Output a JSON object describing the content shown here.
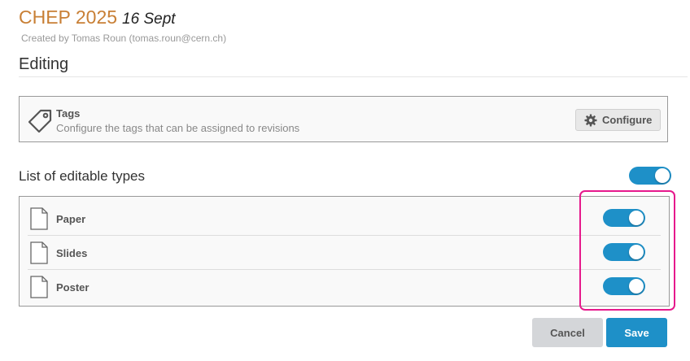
{
  "header": {
    "title": "CHEP 2025",
    "date": "16 Sept",
    "created_by": "Created by Tomas Roun (tomas.roun@cern.ch)"
  },
  "section": {
    "heading": "Editing"
  },
  "tags": {
    "icon": "tag-icon",
    "title": "Tags",
    "description": "Configure the tags that can be assigned to revisions",
    "configure_label": "Configure",
    "configure_icon": "gear-icon"
  },
  "editable_types": {
    "label": "List of editable types",
    "enabled": true,
    "items": [
      {
        "label": "Paper",
        "icon": "file-icon",
        "enabled": true
      },
      {
        "label": "Slides",
        "icon": "file-icon",
        "enabled": true
      },
      {
        "label": "Poster",
        "icon": "file-icon",
        "enabled": true
      }
    ]
  },
  "actions": {
    "cancel_label": "Cancel",
    "save_label": "Save"
  },
  "colors": {
    "accent": "#1e90c8",
    "title": "#c87f35",
    "highlight": "#e6198c"
  }
}
